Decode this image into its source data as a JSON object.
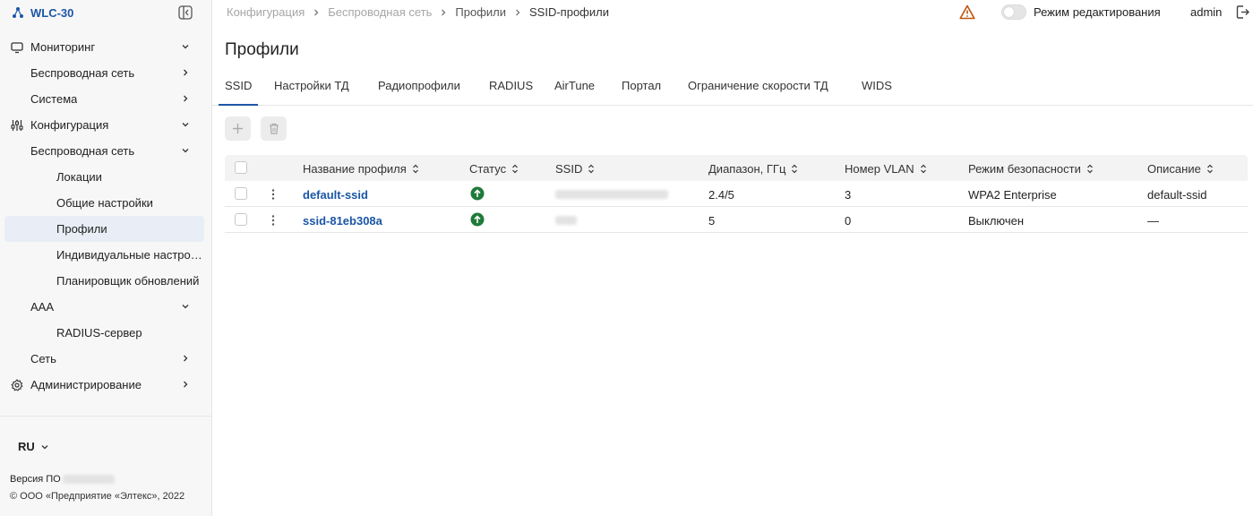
{
  "app": {
    "title": "WLC-30"
  },
  "sidebar": {
    "items": [
      {
        "label": "Мониторинг",
        "icon": "monitor-icon"
      },
      {
        "label": "Беспроводная сеть"
      },
      {
        "label": "Система"
      },
      {
        "label": "Конфигурация",
        "icon": "sliders-icon"
      },
      {
        "label": "Беспроводная сеть"
      },
      {
        "label": "Локации"
      },
      {
        "label": "Общие настройки"
      },
      {
        "label": "Профили",
        "active": true
      },
      {
        "label": "Индивидуальные настройки"
      },
      {
        "label": "Планировщик обновлений"
      },
      {
        "label": "AAA"
      },
      {
        "label": "RADIUS-сервер"
      },
      {
        "label": "Сеть"
      },
      {
        "label": "Администрирование",
        "icon": "gear-icon"
      }
    ],
    "lang": "RU",
    "version_label": "Версия ПО",
    "copyright": "© ООО «Предприятие «Элтекс», 2022"
  },
  "header": {
    "breadcrumb": [
      "Конфигурация",
      "Беспроводная сеть",
      "Профили",
      "SSID-профили"
    ],
    "edit_mode_label": "Режим редактирования",
    "edit_mode_on": false,
    "user": "admin"
  },
  "main": {
    "title": "Профили",
    "tabs": [
      "SSID",
      "Настройки ТД",
      "Радиопрофили",
      "RADIUS",
      "AirTune",
      "Портал",
      "Ограничение скорости ТД",
      "WIDS"
    ],
    "active_tab": "SSID",
    "table": {
      "columns": [
        "Название профиля",
        "Статус",
        "SSID",
        "Диапазон, ГГц",
        "Номер VLAN",
        "Режим безопасности",
        "Описание"
      ],
      "rows": [
        {
          "name": "default-ssid",
          "status": "up",
          "ssid": "",
          "band": "2.4/5",
          "vlan": "3",
          "security": "WPA2 Enterprise",
          "description": "default-ssid"
        },
        {
          "name": "ssid-81eb308a",
          "status": "up",
          "ssid": "",
          "band": "5",
          "vlan": "0",
          "security": "Выключен",
          "description": "—"
        }
      ]
    }
  },
  "colors": {
    "accent": "#1b56a6",
    "status_ok": "#1f7a3a",
    "warning": "#c0540f"
  }
}
